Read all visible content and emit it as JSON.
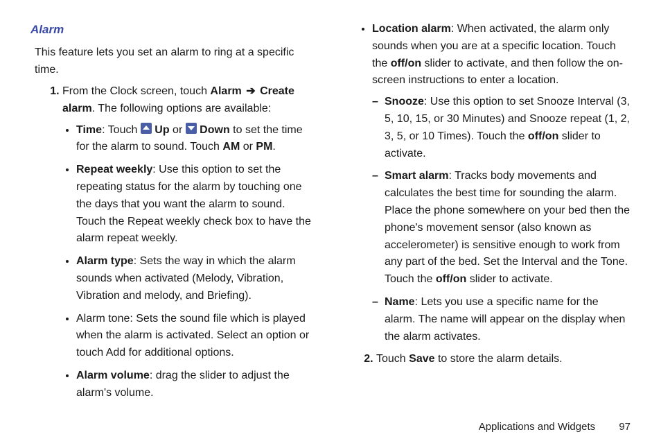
{
  "heading": "Alarm",
  "intro": "This feature lets you set an alarm to ring at a specific time.",
  "step1": {
    "pre": "From the Clock screen, touch ",
    "bold1": "Alarm",
    "arrow": "➔",
    "bold2": "Create alarm",
    "post": ". The following options are available:"
  },
  "time": {
    "label": "Time",
    "t1": ": Touch ",
    "up": "Up",
    "t2": " or ",
    "down": "Down",
    "t3": " to set the time for the alarm to sound. Touch ",
    "am": "AM",
    "t4": " or ",
    "pm": "PM",
    "t5": "."
  },
  "repeat": {
    "label": "Repeat weekly",
    "text": ": Use this option to set the repeating status for the alarm by touching one the days that you want the alarm to sound. Touch the Repeat weekly check box to have the alarm repeat weekly."
  },
  "atype": {
    "label": "Alarm type",
    "text": ": Sets the way in which the alarm sounds when activated (Melody, Vibration, Vibration and melody, and Briefing)."
  },
  "atone": "Alarm tone: Sets the sound file which is played when the alarm is activated. Select an option or touch Add for additional options.",
  "avol": {
    "label": "Alarm volume",
    "text": ": drag the slider to adjust the alarm's volume."
  },
  "loc": {
    "label": "Location alarm",
    "t1": ": When activated, the alarm only sounds when you are at a specific location. Touch the ",
    "offon": "off/on",
    "t2": " slider to activate, and then follow the on-screen instructions to enter a location."
  },
  "snooze": {
    "label": "Snooze",
    "t1": ": Use this option to set Snooze Interval (3, 5, 10, 15, or 30 Minutes) and Snooze repeat (1, 2, 3, 5, or 10 Times). Touch the ",
    "offon": "off/on",
    "t2": " slider to activate."
  },
  "smart": {
    "label": "Smart alarm",
    "t1": ": Tracks body movements and calculates the best time for sounding the alarm. Place the phone somewhere on your bed then the phone's movement sensor (also known as accelerometer) is sensitive enough to work from any part of the bed. Set the Interval and the Tone. Touch the ",
    "offon": "off/on",
    "t2": " slider to activate."
  },
  "name": {
    "label": "Name",
    "text": ": Lets you use a specific name for the alarm. The name will appear on the display when the alarm activates."
  },
  "step2": {
    "t1": "Touch ",
    "save": "Save",
    "t2": " to store the alarm details."
  },
  "footer": {
    "section": "Applications and Widgets",
    "page": "97"
  }
}
